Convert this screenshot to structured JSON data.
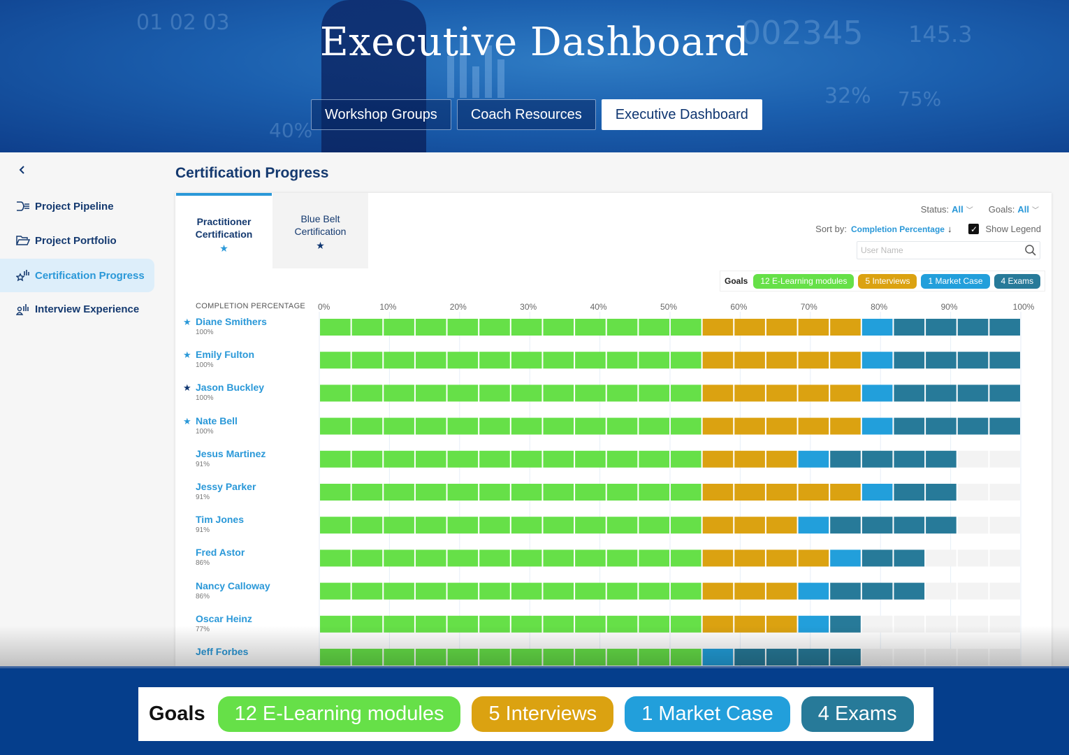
{
  "hero": {
    "title": "Executive Dashboard",
    "nav": [
      {
        "label": "Workshop Groups",
        "active": false
      },
      {
        "label": "Coach Resources",
        "active": false
      },
      {
        "label": "Executive Dashboard",
        "active": true
      }
    ]
  },
  "sidebar": {
    "collapse_icon": "chevron-left-icon",
    "items": [
      {
        "label": "Project Pipeline",
        "icon": "pipeline-icon",
        "active": false
      },
      {
        "label": "Project Portfolio",
        "icon": "folder-open-icon",
        "active": false
      },
      {
        "label": "Certification Progress",
        "icon": "star-chart-icon",
        "active": true
      },
      {
        "label": "Interview Experience",
        "icon": "person-chart-icon",
        "active": false
      }
    ]
  },
  "main": {
    "title": "Certification Progress",
    "tabs": [
      {
        "line1": "Practitioner",
        "line2": "Certification",
        "star": "★",
        "active": true
      },
      {
        "line1": "Blue Belt",
        "line2": "Certification",
        "star": "★",
        "active": false
      }
    ],
    "filters": {
      "status_label": "Status:",
      "status_value": "All",
      "goals_label": "Goals:",
      "goals_value": "All",
      "sort_label": "Sort by:",
      "sort_value": "Completion Percentage",
      "sort_dir": "↓",
      "show_legend_label": "Show Legend",
      "show_legend_checked": true,
      "search_placeholder": "User Name",
      "search_value": ""
    },
    "legend": {
      "label": "Goals",
      "items": [
        {
          "label": "12 E-Learning modules",
          "color": "#66e048"
        },
        {
          "label": "5 Interviews",
          "color": "#dba211"
        },
        {
          "label": "1 Market Case",
          "color": "#229fdb"
        },
        {
          "label": "4 Exams",
          "color": "#277a99"
        }
      ]
    }
  },
  "colors": {
    "elearning": "#66e048",
    "interview": "#dba211",
    "market_case": "#229fdb",
    "exam": "#277a99",
    "empty": "#f3f3f3",
    "accent": "#2a98d8",
    "navy": "#14396f"
  },
  "chart_data": {
    "type": "bar",
    "title": "Certification Progress",
    "xlabel": "COMPLETION PERCENTAGE",
    "x_ticks": [
      "0%",
      "10%",
      "20%",
      "30%",
      "40%",
      "50%",
      "60%",
      "70%",
      "80%",
      "90%",
      "100%"
    ],
    "xlim": [
      0,
      100
    ],
    "total_segments": 22,
    "series_order": [
      "E-Learning modules",
      "Interviews",
      "Market Case",
      "Exams"
    ],
    "rows": [
      {
        "name": "Diane Smithers",
        "pct": "100%",
        "star": "light",
        "segments": [
          12,
          5,
          1,
          4
        ]
      },
      {
        "name": "Emily Fulton",
        "pct": "100%",
        "star": "light",
        "segments": [
          12,
          5,
          1,
          4
        ]
      },
      {
        "name": "Jason Buckley",
        "pct": "100%",
        "star": "dark",
        "segments": [
          12,
          5,
          1,
          4
        ]
      },
      {
        "name": "Nate Bell",
        "pct": "100%",
        "star": "light",
        "segments": [
          12,
          5,
          1,
          4
        ]
      },
      {
        "name": "Jesus Martinez",
        "pct": "91%",
        "star": "none",
        "segments": [
          12,
          3,
          1,
          4
        ]
      },
      {
        "name": "Jessy Parker",
        "pct": "91%",
        "star": "none",
        "segments": [
          12,
          5,
          1,
          2
        ]
      },
      {
        "name": "Tim Jones",
        "pct": "91%",
        "star": "none",
        "segments": [
          12,
          3,
          1,
          4
        ]
      },
      {
        "name": "Fred Astor",
        "pct": "86%",
        "star": "none",
        "segments": [
          12,
          4,
          1,
          2
        ]
      },
      {
        "name": "Nancy Calloway",
        "pct": "86%",
        "star": "none",
        "segments": [
          12,
          3,
          1,
          3
        ]
      },
      {
        "name": "Oscar Heinz",
        "pct": "77%",
        "star": "none",
        "segments": [
          12,
          3,
          1,
          1
        ]
      },
      {
        "name": "Jeff Forbes",
        "pct": "",
        "star": "none",
        "segments": [
          12,
          0,
          1,
          4
        ]
      }
    ]
  },
  "banner": {
    "label": "Goals",
    "items": [
      {
        "label": "12 E-Learning modules",
        "color": "#66e048"
      },
      {
        "label": "5 Interviews",
        "color": "#dba211"
      },
      {
        "label": "1 Market Case",
        "color": "#229fdb"
      },
      {
        "label": "4 Exams",
        "color": "#277a99"
      }
    ]
  }
}
